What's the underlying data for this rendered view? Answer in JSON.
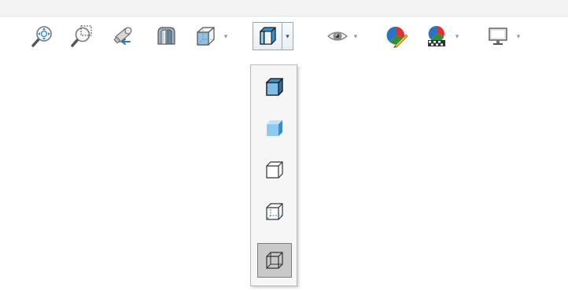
{
  "toolbar": {
    "buttons": [
      {
        "icon": "zoom-to-fit-icon",
        "has_dropdown": false
      },
      {
        "icon": "zoom-to-area-icon",
        "has_dropdown": false
      },
      {
        "icon": "previous-view-icon",
        "has_dropdown": false
      },
      {
        "icon": "section-view-icon",
        "has_dropdown": false
      },
      {
        "icon": "view-orientation-icon",
        "has_dropdown": true
      },
      {
        "icon": "display-style-icon",
        "has_dropdown": true,
        "active": true
      },
      {
        "icon": "hide-show-items-icon",
        "has_dropdown": true
      },
      {
        "icon": "edit-appearance-icon",
        "has_dropdown": false
      },
      {
        "icon": "apply-scene-icon",
        "has_dropdown": true
      },
      {
        "icon": "view-settings-icon",
        "has_dropdown": true
      }
    ]
  },
  "display_style_flyout": {
    "items": [
      {
        "icon": "shaded-with-edges-icon"
      },
      {
        "icon": "shaded-icon"
      },
      {
        "icon": "hidden-lines-removed-icon"
      },
      {
        "icon": "hidden-lines-visible-icon"
      },
      {
        "icon": "wireframe-icon",
        "selected": true
      }
    ]
  },
  "colors": {
    "accent_blue": "#3d8fc9",
    "selected_bg": "#c9c9c9",
    "flyout_bg": "#f6f6f6"
  }
}
